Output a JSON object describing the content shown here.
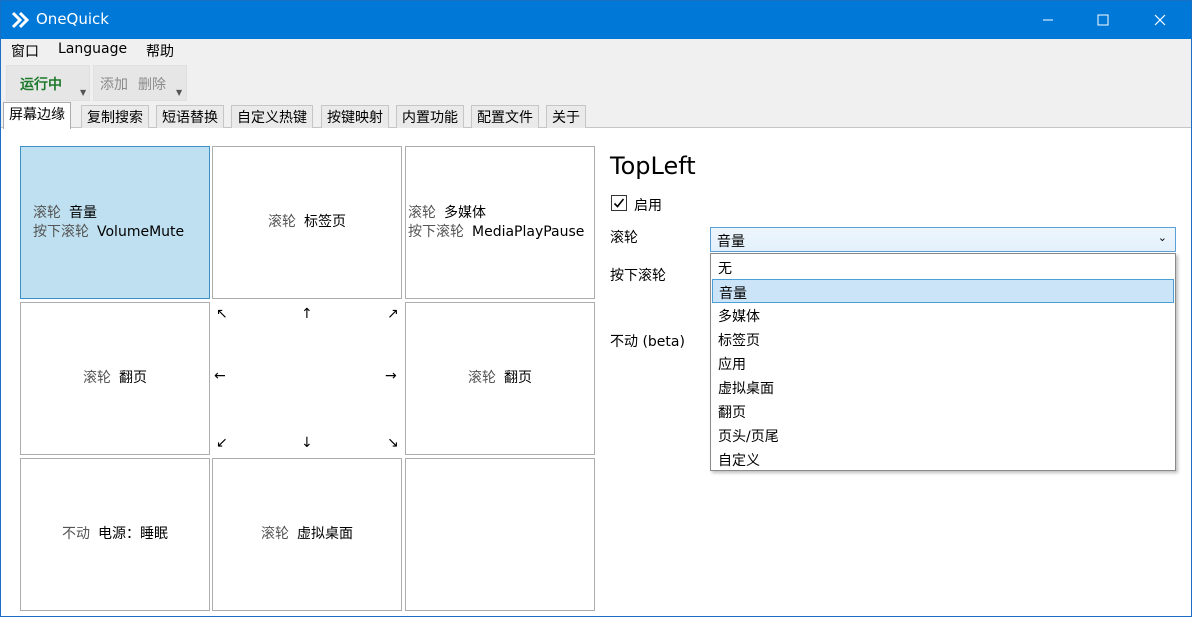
{
  "window": {
    "title": "OneQuick"
  },
  "menu": {
    "items": [
      "窗口",
      "Language",
      "帮助"
    ]
  },
  "toolbar": {
    "status_label": "运行中",
    "add_label": "添加",
    "delete_label": "删除"
  },
  "tabs": [
    "屏幕边缘",
    "复制搜索",
    "短语替换",
    "自定义热键",
    "按键映射",
    "内置功能",
    "配置文件",
    "关于"
  ],
  "grid": {
    "top_left": {
      "lines": [
        {
          "key": "滚轮",
          "value": "音量"
        },
        {
          "key": "按下滚轮",
          "value": "VolumeMute"
        }
      ]
    },
    "top": {
      "key": "滚轮",
      "value": "标签页"
    },
    "top_right": {
      "lines": [
        {
          "key": "滚轮",
          "value": "多媒体"
        },
        {
          "key": "按下滚轮",
          "value": "MediaPlayPause"
        }
      ]
    },
    "left": {
      "key": "滚轮",
      "value": "翻页"
    },
    "right": {
      "key": "滚轮",
      "value": "翻页"
    },
    "bottom_left": {
      "key": "不动",
      "value": "电源：睡眠"
    },
    "bottom": {
      "key": "滚轮",
      "value": "虚拟桌面"
    }
  },
  "arrows": {
    "up_left": "↖",
    "up": "↑",
    "up_right": "↗",
    "left": "←",
    "right": "→",
    "down_left": "↙",
    "down": "↓",
    "down_right": "↘"
  },
  "detail": {
    "heading": "TopLeft",
    "enabled_label": "启用",
    "wheel_label": "滚轮",
    "press_wheel_label": "按下滚轮",
    "idle_label": "不动 (beta)",
    "wheel_value": "音量",
    "options": [
      "无",
      "音量",
      "多媒体",
      "标签页",
      "应用",
      "虚拟桌面",
      "翻页",
      "页头/页尾",
      "自定义"
    ]
  }
}
